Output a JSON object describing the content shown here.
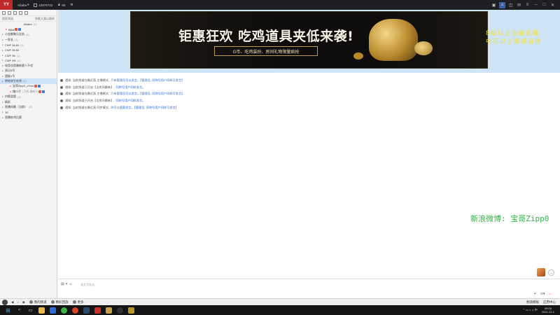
{
  "topbar": {
    "user_name": "Ababa",
    "id_label": "12976722",
    "fans_label": "56",
    "logo_text": "YY"
  },
  "sidebar": {
    "search_placeholder": "搜索频道",
    "search_hint": "按最大量以最新",
    "header_label": "Ababa",
    "header_count": "(1)",
    "rows": [
      {
        "label": "Bilidi",
        "count": "",
        "indent": 1,
        "selected": false
      },
      {
        "label": "小金额聚乐业务",
        "count": "(1)",
        "indent": 0,
        "selected": false
      },
      {
        "label": "一家长",
        "count": "(1)",
        "indent": 0,
        "selected": false
      },
      {
        "label": "CWF 36 84",
        "count": "(1)",
        "indent": 0,
        "selected": false
      },
      {
        "label": "CWF 36 84",
        "count": "",
        "indent": 0,
        "selected": false
      },
      {
        "label": "CWF 36",
        "count": "(1)",
        "indent": 0,
        "selected": false
      },
      {
        "label": "CWF 4N",
        "count": "(1)",
        "indent": 0,
        "selected": false
      },
      {
        "label": "电竞也是最新更人不也",
        "count": "",
        "indent": 0,
        "selected": false
      },
      {
        "label": "直记5号",
        "count": "",
        "indent": 0,
        "selected": false
      },
      {
        "label": "超级1号",
        "count": "",
        "indent": 0,
        "selected": false
      },
      {
        "label": "绝地求生吃鸡",
        "count": "(1)",
        "indent": 0,
        "selected": true
      },
      {
        "label": "宝哥Zipp0_oTool",
        "count": "",
        "indent": 2,
        "selected": false
      },
      {
        "label": "路口子",
        "count": "(下机-最新5)",
        "indent": 2,
        "selected": false
      },
      {
        "label": "内推监管",
        "count": "(1)",
        "indent": 0,
        "selected": false
      },
      {
        "label": "精彩",
        "count": "",
        "indent": 0,
        "selected": false
      },
      {
        "label": "直播间最（当前）",
        "count": "(1)",
        "indent": 0,
        "selected": false
      },
      {
        "label": "16",
        "count": "",
        "indent": 0,
        "selected": false
      },
      {
        "label": "直播吃鸡比赛",
        "count": "",
        "indent": 0,
        "selected": false
      }
    ]
  },
  "banner": {
    "title": "钜惠狂欢 吃鸡道具夹低来袭!",
    "subtitle": "G币、吃鸡装扮、房间礼物限量疯抢"
  },
  "overlays": {
    "yellow_line1": "8级以上当前直播",
    "yellow_line2": "中间以上等级直播",
    "green_text": "新浪微博: 宝哥Zipp0"
  },
  "messages": [
    {
      "text": "通知: 当前频道在最近直 主播模式,",
      "link": "只有管理员可以发言。【管理员, 同称号用户同样可发言】"
    },
    {
      "text": "通知: 当前频道已开启【全房间最新】,",
      "link": "同称号用户同样发言。"
    },
    {
      "text": "通知: 当前频道在最近直 主播模式,",
      "link": "只有管理员可以发言。【管理员, 同称号用户同样可发言】"
    },
    {
      "text": "通知: 当前频道已开启【全房间最新】,",
      "link": "同称号用户同样发言。"
    },
    {
      "text": "通知: 当前频道在最近直 同步模式,",
      "link": "你可以随意发言。【管理员, 同称号用户同样可发言】"
    }
  ],
  "input": {
    "placeholder": "请文字发送...",
    "send_label": "发送"
  },
  "footer": {
    "items": [
      "我的频道",
      "精彩回放",
      "更多"
    ],
    "right_items": [
      "频道模板",
      "应用中心"
    ]
  },
  "taskbar": {
    "time": "09:05",
    "date": "2022-12-1"
  }
}
